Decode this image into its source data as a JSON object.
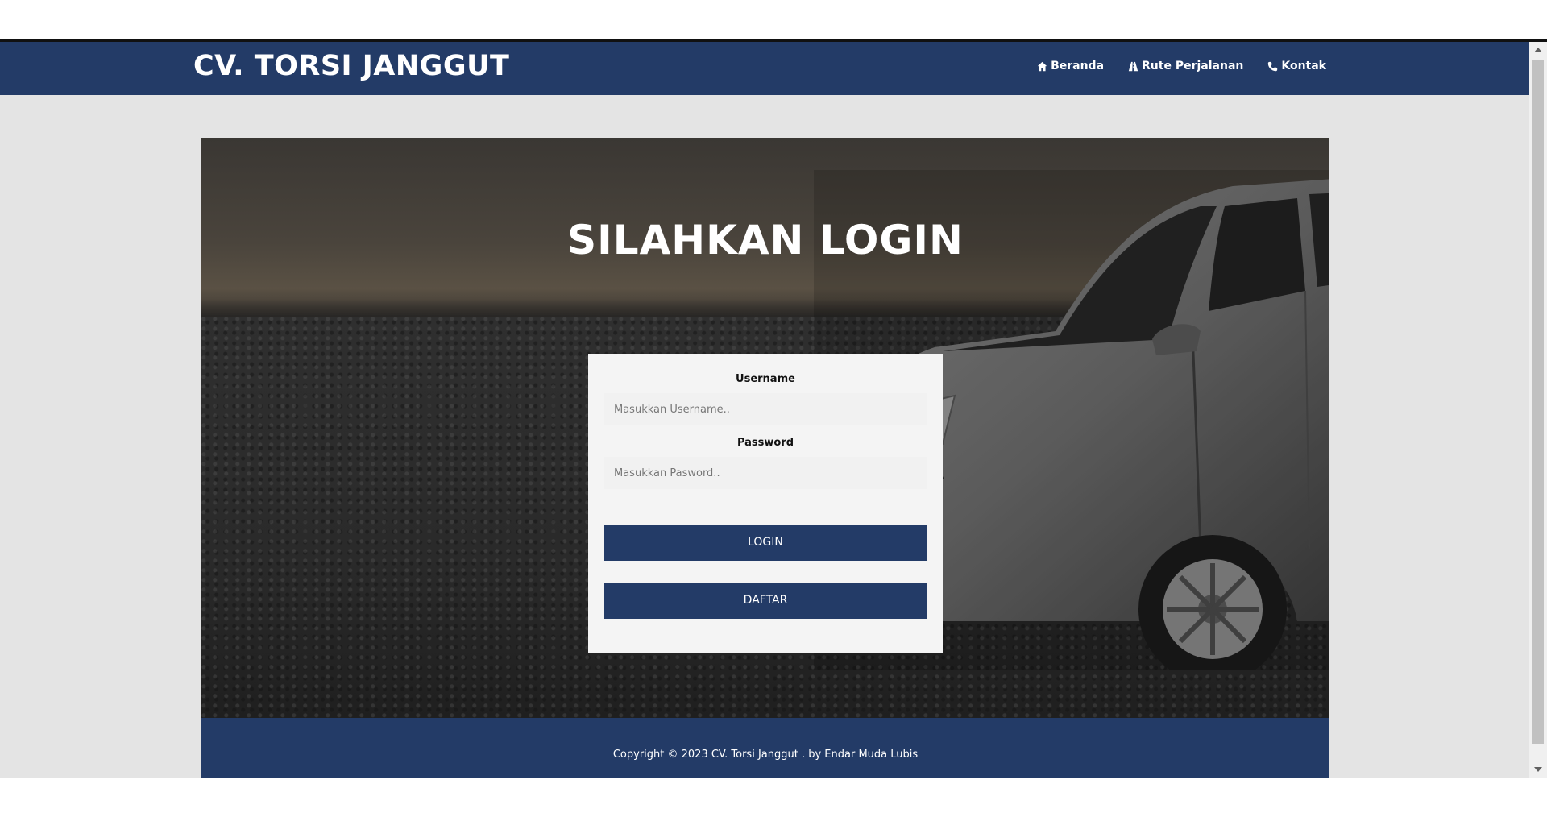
{
  "brand": {
    "title": "CV. TORSI JANGGUT"
  },
  "nav": {
    "items": [
      {
        "label": "Beranda",
        "icon": "home-icon"
      },
      {
        "label": "Rute Perjalanan",
        "icon": "road-icon"
      },
      {
        "label": "Kontak",
        "icon": "phone-icon"
      }
    ]
  },
  "hero": {
    "title": "SILAHKAN LOGIN"
  },
  "login": {
    "username_label": "Username",
    "username_placeholder": "Masukkan Username..",
    "password_label": "Password",
    "password_placeholder": "Masukkan Pasword..",
    "login_button": "LOGIN",
    "register_button": "DAFTAR"
  },
  "footer": {
    "text": "Copyright © 2023 CV. Torsi Janggut . by Endar Muda Lubis"
  },
  "colors": {
    "primary": "#233b67",
    "background": "#e4e4e4",
    "card": "#f4f4f4"
  }
}
